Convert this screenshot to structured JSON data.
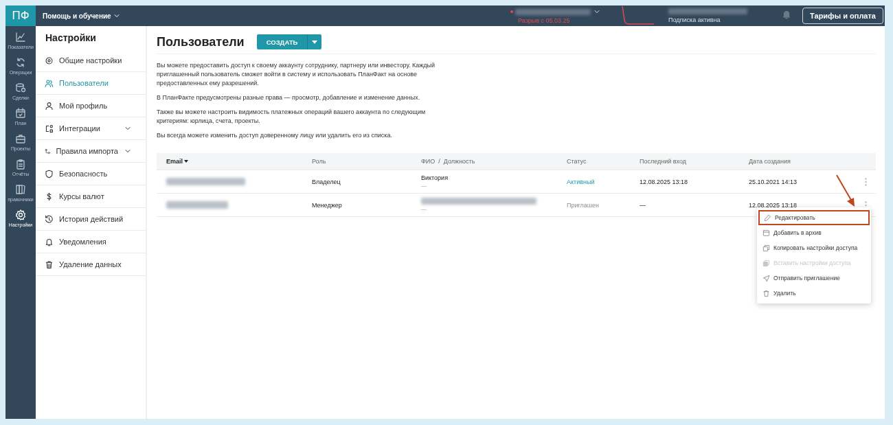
{
  "topbar": {
    "logo": "ПФ",
    "help_menu": "Помощь и обучение",
    "gap_notice": "Разрыв с 05.03.25",
    "subscription": "Подписка активна",
    "tariffs_button": "Тарифы и оплата"
  },
  "rail": [
    {
      "label": "Показатели",
      "selected": false
    },
    {
      "label": "Операции",
      "selected": false
    },
    {
      "label": "Сделки",
      "selected": false
    },
    {
      "label": "План",
      "selected": false
    },
    {
      "label": "Проекты",
      "selected": false
    },
    {
      "label": "Отчёты",
      "selected": false
    },
    {
      "label": "правочники",
      "selected": false
    },
    {
      "label": "Настройки",
      "selected": true
    }
  ],
  "sidebar": {
    "title": "Настройки",
    "items": [
      {
        "label": "Общие настройки",
        "selected": false,
        "expandable": false
      },
      {
        "label": "Пользователи",
        "selected": true,
        "expandable": false
      },
      {
        "label": "Мой профиль",
        "selected": false,
        "expandable": false
      },
      {
        "label": "Интеграции",
        "selected": false,
        "expandable": true
      },
      {
        "label": "Правила импорта",
        "selected": false,
        "expandable": true
      },
      {
        "label": "Безопасность",
        "selected": false,
        "expandable": false
      },
      {
        "label": "Курсы валют",
        "selected": false,
        "expandable": false
      },
      {
        "label": "История действий",
        "selected": false,
        "expandable": false
      },
      {
        "label": "Уведомления",
        "selected": false,
        "expandable": false
      },
      {
        "label": "Удаление данных",
        "selected": false,
        "expandable": false
      }
    ]
  },
  "page": {
    "title": "Пользователи",
    "create_button": "СОЗДАТЬ",
    "paragraphs": [
      "Вы можете предоставить доступ к своему аккаунту сотруднику, партнеру или инвестору. Каждый приглашенный пользователь сможет войти в систему и использовать ПланФакт на основе предоставленных ему разрешений.",
      "В ПланФакте предусмотрены разные права — просмотр, добавление и изменение данных.",
      "Также вы можете настроить видимость платежных операций вашего аккаунта по следующим критериям: юрлица, счета, проекты.",
      "Вы всегда можете изменить доступ доверенному лицу или удалить его из списка."
    ]
  },
  "table": {
    "columns": [
      "Email",
      "Роль",
      "ФИО",
      "/",
      "Должность",
      "Статус",
      "Последний вход",
      "Дата создания"
    ],
    "rows": [
      {
        "role": "Владелец",
        "name": "Виктория",
        "position": "—",
        "status": "Активный",
        "kind": "active",
        "last_login": "12.08.2025 13:18",
        "created": "25.10.2021 14:13"
      },
      {
        "role": "Менеджер",
        "position": "—",
        "status": "Приглашен",
        "kind": "invited",
        "last_login": "—",
        "created": "12.08.2025 13:18"
      }
    ]
  },
  "context_menu": [
    {
      "label": "Редактировать",
      "selected": true,
      "disabled": false
    },
    {
      "label": "Добавить в архив",
      "selected": false,
      "disabled": false
    },
    {
      "label": "Копировать настройки доступа",
      "selected": false,
      "disabled": false
    },
    {
      "label": "Вставить настройки доступа",
      "selected": false,
      "disabled": true
    },
    {
      "label": "Отправить приглашение",
      "selected": false,
      "disabled": false
    },
    {
      "label": "Удалить",
      "selected": false,
      "disabled": false
    }
  ]
}
